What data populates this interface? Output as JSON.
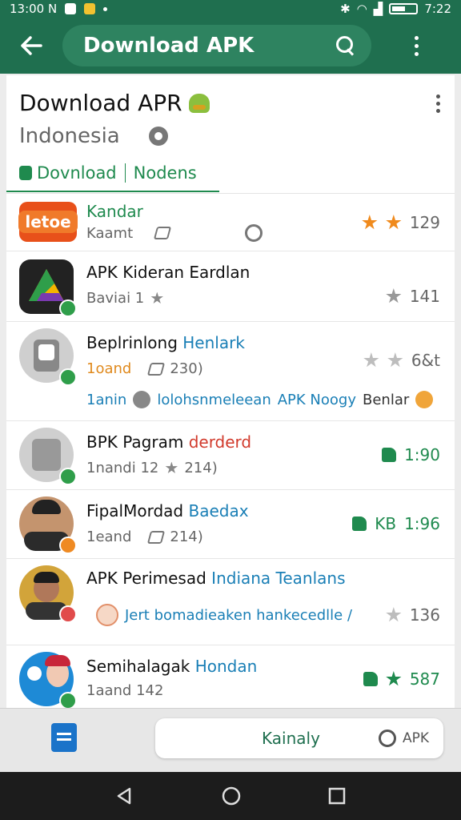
{
  "status_bar": {
    "time_left": "13:00 N",
    "time_right": "7:22"
  },
  "app_bar": {
    "title": "Download APK"
  },
  "header": {
    "title": "Download APR",
    "subtitle": "Indonesia",
    "tabs": [
      "Dovnload",
      "Nodens"
    ]
  },
  "rows": [
    {
      "thumb_text": "letoe",
      "title_hl": "Kandar",
      "subtitle": "Kaamt",
      "right": "129"
    },
    {
      "title": "APK Kideran Eardlan",
      "subtitle": "Baviai 1",
      "right": "141"
    },
    {
      "title": "Beplrinlong ",
      "title_hl": "Henlark",
      "subtitle_orange": "1oand",
      "subtitle": "230)",
      "right": "6&t",
      "extra_a": "1anin",
      "extra_b": "lolohsnmeleean",
      "extra_c": "APK Noogy",
      "extra_d": "Benlar"
    },
    {
      "title": "BPK Pagram ",
      "title_hl": "derderd",
      "subtitle": "1nandi 12",
      "subtitle2": "214)",
      "right": "1:90"
    },
    {
      "title": "FipalMordad ",
      "title_hl": "Baedax",
      "subtitle": "1eand",
      "subtitle2": "214)",
      "right_prefix": "KB",
      "right": "1:96"
    },
    {
      "title": "APK Perimesad ",
      "title_hl": "Indiana Teanlans",
      "extra": "Jert bomadieaken hankecedlle /",
      "right": "136"
    },
    {
      "title": "Semihalagak ",
      "title_hl": "Hondan",
      "subtitle": "1aand 142",
      "right": "587"
    }
  ],
  "bottom": {
    "action_label": "Kainaly",
    "action_right": "APK"
  }
}
